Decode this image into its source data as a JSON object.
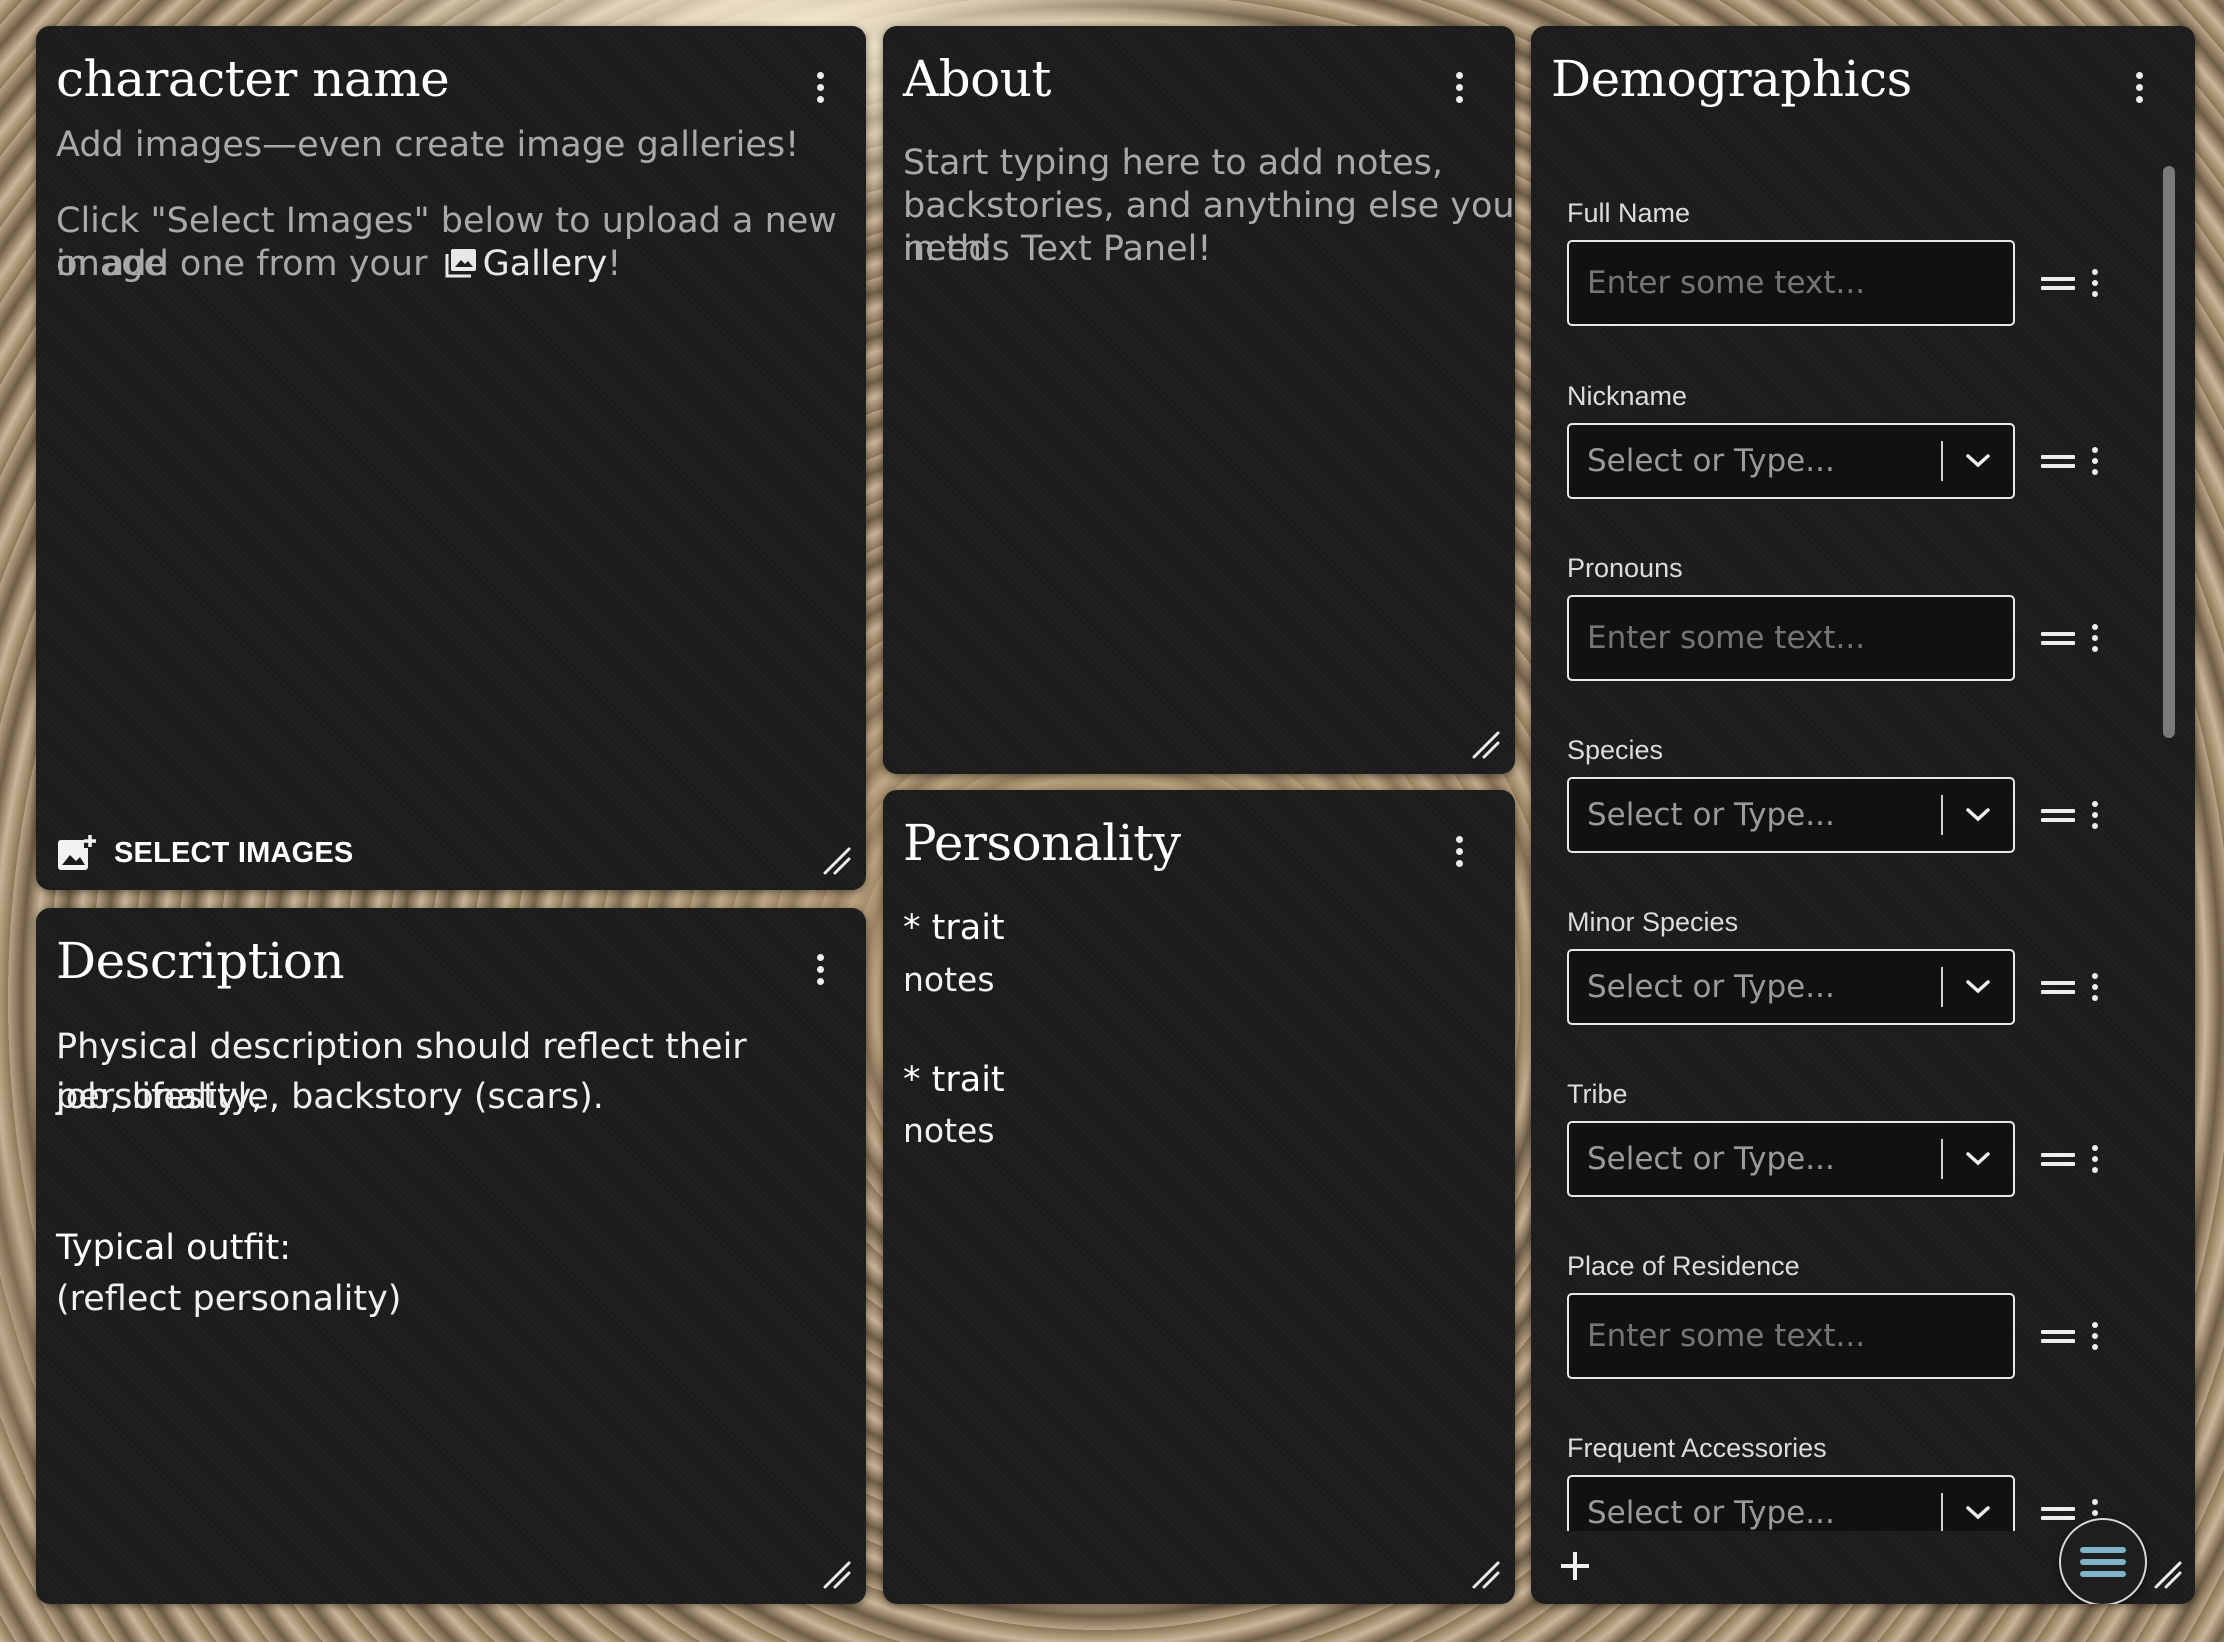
{
  "character_panel": {
    "title": "character name",
    "hint_line1": "Add images—even create image galleries!",
    "hint_line2_a": "Click \"Select Images\" below to upload a new image",
    "hint_line2_b": "or add one from your",
    "gallery_label": "Gallery",
    "gallery_suffix": "!",
    "select_images_label": "SELECT IMAGES"
  },
  "description_panel": {
    "title": "Description",
    "line1": "Physical description should reflect their personality,",
    "line2": "job, lifestyle, backstory (scars).",
    "outfit_heading": "Typical outfit:",
    "outfit_note": "(reflect personality)"
  },
  "about_panel": {
    "title": "About",
    "line1": "Start typing here to add notes,",
    "line2": "backstories, and anything else you need",
    "line3": "in this Text Panel!"
  },
  "personality_panel": {
    "title": "Personality",
    "items": [
      {
        "bullet": "*",
        "trait": "trait",
        "notes": "notes"
      },
      {
        "bullet": "*",
        "trait": "trait",
        "notes": "notes"
      }
    ]
  },
  "demographics_panel": {
    "title": "Demographics",
    "fields": [
      {
        "label": "Full Name",
        "kind": "text",
        "placeholder": "Enter some text..."
      },
      {
        "label": "Nickname",
        "kind": "select",
        "placeholder": "Select or Type..."
      },
      {
        "label": "Pronouns",
        "kind": "text",
        "placeholder": "Enter some text..."
      },
      {
        "label": "Species",
        "kind": "select",
        "placeholder": "Select or Type..."
      },
      {
        "label": "Minor Species",
        "kind": "select",
        "placeholder": "Select or Type..."
      },
      {
        "label": "Tribe",
        "kind": "select",
        "placeholder": "Select or Type..."
      },
      {
        "label": "Place of Residence",
        "kind": "text",
        "placeholder": "Enter some text..."
      },
      {
        "label": "Frequent Accessories",
        "kind": "select",
        "placeholder": "Select or Type..."
      }
    ],
    "add_icon": "plus-icon",
    "menu_icon": "hamburger-menu-icon"
  },
  "colors": {
    "panel_bg": "#1c1c1c",
    "text_primary": "#ffffff",
    "text_muted": "#a9a9a9",
    "field_border": "#e8e8e8",
    "fab_icon": "#7fb3c8"
  }
}
